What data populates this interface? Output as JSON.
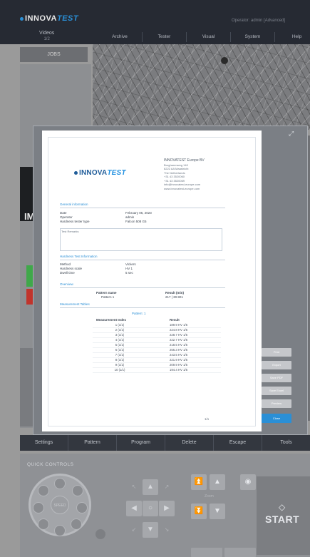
{
  "header": {
    "logo_main": "INNOVA",
    "logo_accent": "TEST",
    "videos_label": "Videos",
    "videos_sub": "1/2",
    "operator": "Operator: admin  [Advanced]",
    "menu": [
      "Archive",
      "Tester",
      "Visual",
      "System",
      "Help"
    ]
  },
  "left": {
    "jobs_tab": "JOBS",
    "im_label": "IM"
  },
  "toolbar": [
    "Settings",
    "Pattern",
    "Program",
    "Delete",
    "Escape",
    "Tools"
  ],
  "quick_controls": {
    "title": "QUICK CONTROLS",
    "wheel_center": "SPEED",
    "zoom_label": "Zoom",
    "start_label": "START"
  },
  "report": {
    "logo_main": "INNOVA",
    "logo_accent": "TEST",
    "company_name": "INNOVATEST Europe BV",
    "company_lines": [
      "Borgharenweg 140",
      "6222 AA Maastricht",
      "The Netherlands",
      "",
      "+31 43 3520060",
      "+31 43 3520069",
      "info@innovatest-europe.com",
      "www.innovatest-europe.com"
    ],
    "general_title": "General information",
    "general_rows": [
      {
        "label": "Date",
        "value": "February 06, 2023"
      },
      {
        "label": "Operator",
        "value": "admin"
      },
      {
        "label": "Hardness tester type",
        "value": "Falcon 508 G5"
      }
    ],
    "remarks_label": "Test Remarks",
    "test_info_title": "Hardness Test Information",
    "test_info_rows": [
      {
        "label": "Method",
        "value": "Vickers"
      },
      {
        "label": "Hardness scale",
        "value": "HV 1"
      },
      {
        "label": "Dwell time",
        "value": "5 sec"
      }
    ],
    "overview_title": "Overview",
    "overview_headers": [
      "Pattern name",
      "Result (min)"
    ],
    "overview_row": [
      "Pattern 1",
      "217 | 30.901"
    ],
    "measurement_title": "Measurement Tables",
    "pattern_caption": "Pattern: 1",
    "table_headers": [
      "Measurement Index",
      "Result"
    ],
    "table_rows": [
      [
        "1 (1/1)",
        "189.9 HV 1/5"
      ],
      [
        "2 (1/1)",
        "224.8 HV 1/5"
      ],
      [
        "3 (1/1)",
        "228.7 HV 1/5"
      ],
      [
        "4 (1/1)",
        "222.7 HV 1/5"
      ],
      [
        "5 (1/1)",
        "218.5 HV 1/5"
      ],
      [
        "6 (1/1)",
        "256.3 HV 1/5"
      ],
      [
        "7 (1/1)",
        "243.5 HV 1/5"
      ],
      [
        "8 (1/1)",
        "221.9 HV 1/5"
      ],
      [
        "9 (1/1)",
        "209.9 HV 1/5"
      ],
      [
        "10 (1/1)",
        "194.4 HV 1/5"
      ]
    ],
    "page_number": "1/1"
  },
  "modal_buttons": [
    "Print",
    "Export",
    "Save PDF",
    "Save Excel",
    "Preview",
    "Close"
  ],
  "colors": {
    "accent": "#2a8fd6",
    "topbar": "#262a33",
    "status_green": "#3fa84a",
    "status_red": "#c0342c"
  }
}
